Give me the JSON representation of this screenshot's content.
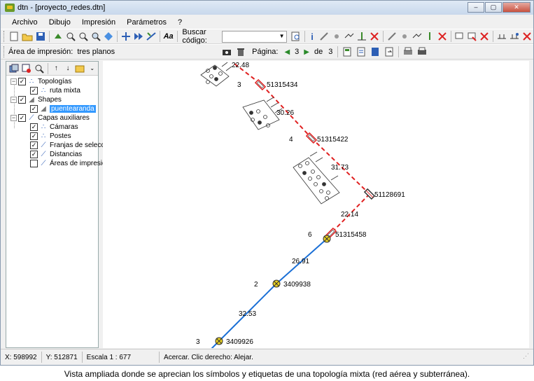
{
  "window": {
    "title": "dtn - [proyecto_redes.dtn]",
    "controls": [
      "–",
      "▢",
      "✕"
    ]
  },
  "menu": [
    "Archivo",
    "Dibujo",
    "Impresión",
    "Parámetros",
    "?"
  ],
  "toolbar": {
    "search_label": "Buscar código:",
    "search_value": ""
  },
  "print_bar": {
    "area_label": "Área de impresión:",
    "area_value": "tres planos",
    "page_label": "Página:",
    "page_current": "3",
    "page_of": "de",
    "page_total": "3"
  },
  "tree": {
    "topologias": "Topologías",
    "ruta_mixta": "ruta mixta",
    "shapes": "Shapes",
    "puentearanda": "puentearanda",
    "capas_aux": "Capas auxiliares",
    "camaras": "Cámaras",
    "postes": "Postes",
    "franjas": "Franjas de selección",
    "distancias": "Distancias",
    "areas": "Áreas de impresión"
  },
  "map": {
    "labels": [
      {
        "text": "22.48"
      },
      {
        "text": "3"
      },
      {
        "text": "51315434"
      },
      {
        "text": "30.26"
      },
      {
        "text": "4"
      },
      {
        "text": "51315422"
      },
      {
        "text": "31.73"
      },
      {
        "text": "51128691"
      },
      {
        "text": "22.14"
      },
      {
        "text": "6"
      },
      {
        "text": "51315458"
      },
      {
        "text": "26.91"
      },
      {
        "text": "2"
      },
      {
        "text": "3409938"
      },
      {
        "text": "32.53"
      },
      {
        "text": "3"
      },
      {
        "text": "3409926"
      }
    ],
    "colors": {
      "aerial": "#e02020",
      "underground": "#1a6fd6",
      "pole_fill": "#e8d020"
    }
  },
  "status": {
    "x": "X: 598992",
    "y": "Y: 512871",
    "scale": "Escala 1 : 677",
    "hint": "Acercar. Clic derecho: Alejar."
  },
  "caption": "Vista ampliada donde se aprecian los símbolos y etiquetas de una topología mixta (red aérea y subterránea)."
}
